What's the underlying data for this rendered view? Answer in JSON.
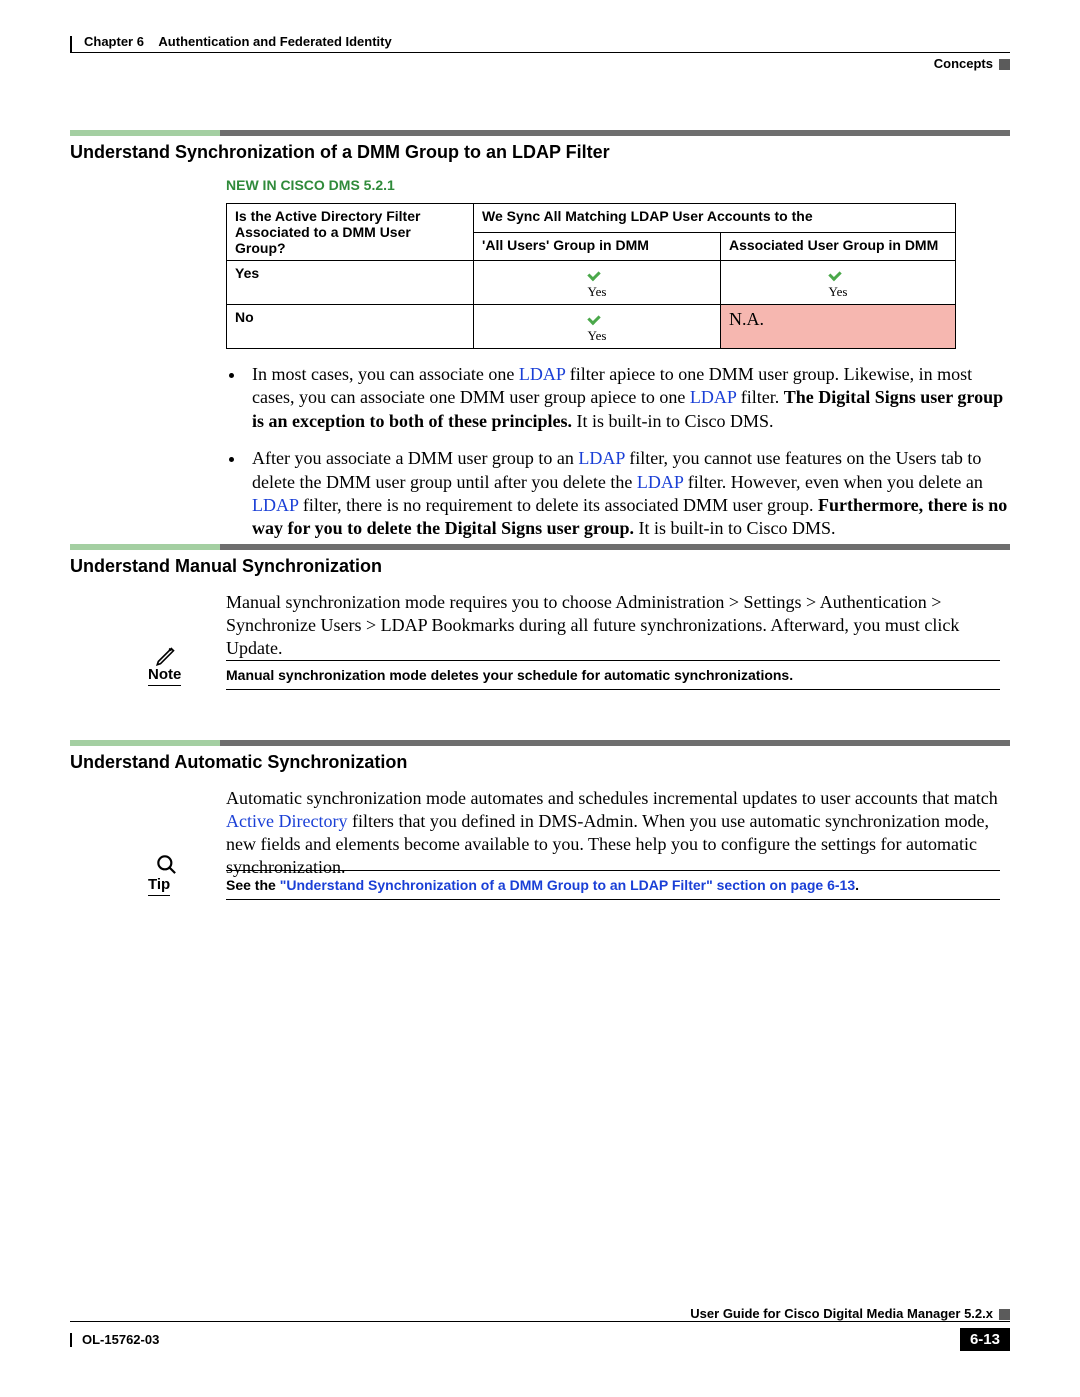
{
  "header": {
    "chapter_label": "Chapter 6",
    "chapter_title": "Authentication and Federated Identity",
    "right_label": "Concepts"
  },
  "section1": {
    "heading": "Understand Synchronization of a DMM Group to an LDAP Filter",
    "new_in": "NEW IN CISCO DMS 5.2.1",
    "table": {
      "col1_header": "Is the Active Directory Filter Associated to a DMM User Group?",
      "col_span_header": "We Sync All Matching LDAP User Accounts to the",
      "sub1": "'All Users' Group in DMM",
      "sub2": "Associated User Group in DMM",
      "rows": [
        {
          "label": "Yes",
          "c2_check": true,
          "c2_text": "Yes",
          "c3_check": true,
          "c3_text": "Yes",
          "c3_na": false
        },
        {
          "label": "No",
          "c2_check": true,
          "c2_text": "Yes",
          "c3_check": false,
          "c3_text": "N.A.",
          "c3_na": true
        }
      ]
    },
    "bullets": {
      "b1_pre": "In most cases, you can associate one ",
      "b1_link1": "LDAP",
      "b1_mid1": " filter apiece to one DMM user group. Likewise, in most cases, you can associate one DMM user group apiece to one ",
      "b1_link2": "LDAP",
      "b1_mid2": " filter. ",
      "b1_bold": "The Digital Signs user group is an exception to both of these principles.",
      "b1_post": " It is built-in to Cisco DMS.",
      "b2_pre": "After you associate a DMM user group to an ",
      "b2_link1": "LDAP",
      "b2_mid1": " filter, you cannot use features on the Users tab to delete the DMM user group until after you delete the ",
      "b2_link2": "LDAP",
      "b2_mid2": " filter. However, even when you delete an ",
      "b2_link3": "LDAP",
      "b2_mid3": " filter, there is no requirement to delete its associated DMM user group. ",
      "b2_bold": "Furthermore, there is no way for you to delete the Digital Signs user group.",
      "b2_post": " It is built-in to Cisco DMS."
    }
  },
  "section2": {
    "heading": "Understand Manual Synchronization",
    "para": "Manual synchronization mode requires you to choose Administration > Settings > Authentication > Synchronize Users > LDAP Bookmarks during all future synchronizations. Afterward, you must click Update."
  },
  "note": {
    "label": "Note",
    "text": "Manual synchronization mode deletes your schedule for automatic synchronizations."
  },
  "section3": {
    "heading": "Understand Automatic Synchronization",
    "para_pre": "Automatic synchronization mode automates and schedules incremental updates to user accounts that match ",
    "para_link": "Active Directory",
    "para_post": " filters that you defined in DMS-Admin. When you use automatic synchronization mode, new fields and elements become available to you. These help you to configure the settings for automatic synchronization."
  },
  "tip": {
    "label": "Tip",
    "pre": "See the ",
    "link": "\"Understand Synchronization of a DMM Group to an LDAP Filter\" section on page 6-13",
    "post": "."
  },
  "footer": {
    "guide": "User Guide for Cisco Digital Media Manager 5.2.x",
    "doc": "OL-15762-03",
    "page": "6-13"
  }
}
